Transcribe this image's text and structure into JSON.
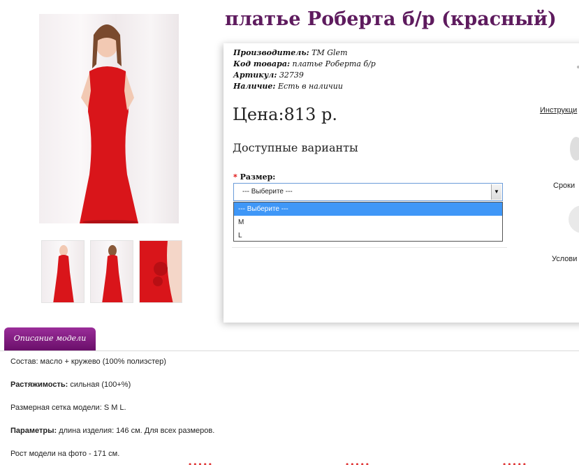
{
  "product": {
    "title": "платье Роберта б/р (красный)",
    "manufacturer_label": "Производитель:",
    "manufacturer": "ТМ Glem",
    "code_label": "Код товара:",
    "code": "платье Роберта б/р",
    "sku_label": "Артикул:",
    "sku": "32739",
    "stock_label": "Наличие:",
    "stock": "Есть в наличии",
    "price": "Цена:813 р.",
    "variants_title": "Доступные варианты"
  },
  "options": {
    "size_label": "Размер:",
    "selected": "--- Выберите ---",
    "items": [
      "--- Выберите ---",
      "M",
      "L"
    ]
  },
  "side_links": {
    "instructions": "Инструкци",
    "terms": "Сроки",
    "conditions": "Услови"
  },
  "tabs": {
    "description": "Описание модели"
  },
  "description": {
    "composition_label": "Состав:",
    "composition": " масло + кружево (100% полиэстер)",
    "stretch_label": "Растяжимость:",
    "stretch": " сильная (100+%)",
    "sizes": "Размерная сетка модели: S M L.",
    "params_label": "Параметры:",
    "params": " длина изделия: 146 см. Для всех размеров.",
    "model_height": "Рост модели на фото - 171 см."
  },
  "colors": {
    "title": "#5e1b5e",
    "tab": "#7b1a7b",
    "dress": "#d9151a",
    "highlight": "#3f97f7"
  }
}
